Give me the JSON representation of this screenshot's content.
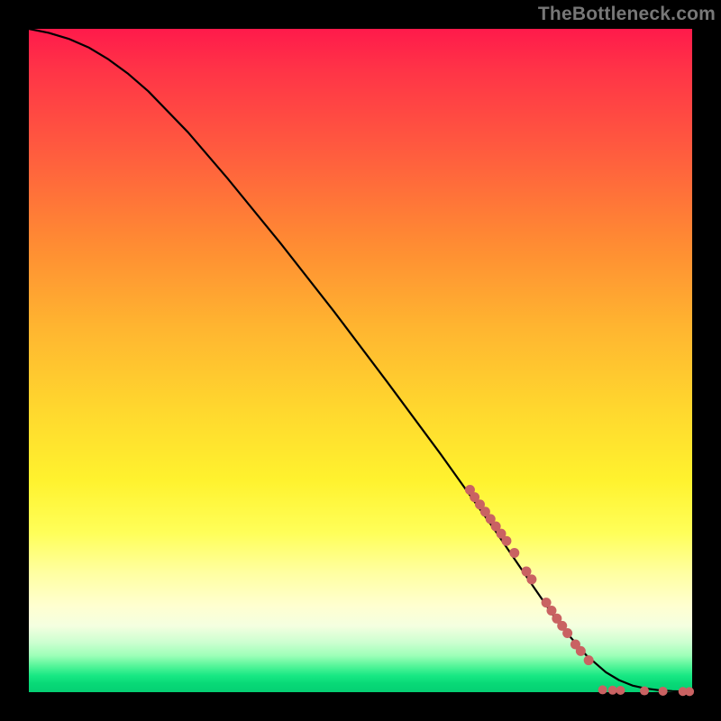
{
  "watermark": "TheBottleneck.com",
  "colors": {
    "dot": "#c96262",
    "curve": "#000000",
    "frame": "#000000"
  },
  "chart_data": {
    "type": "line",
    "title": "",
    "xlabel": "",
    "ylabel": "",
    "xlim": [
      0,
      100
    ],
    "ylim": [
      0,
      100
    ],
    "grid": false,
    "legend": null,
    "series": [
      {
        "name": "bottleneck-curve",
        "kind": "line",
        "x": [
          0,
          3,
          6,
          9,
          12,
          15,
          18,
          24,
          30,
          38,
          46,
          54,
          62,
          70,
          76,
          80,
          84,
          87,
          89,
          91,
          93,
          95,
          97,
          99,
          100
        ],
        "y": [
          100,
          99.4,
          98.5,
          97.2,
          95.4,
          93.2,
          90.6,
          84.4,
          77.4,
          67.6,
          57.4,
          46.8,
          36.0,
          24.8,
          16.0,
          10.2,
          5.6,
          3.0,
          1.8,
          1.0,
          0.55,
          0.3,
          0.16,
          0.08,
          0.06
        ]
      },
      {
        "name": "highlighted-points",
        "kind": "scatter",
        "points": [
          {
            "x": 66.5,
            "y": 30.5,
            "r": 5.5
          },
          {
            "x": 67.2,
            "y": 29.4,
            "r": 5.5
          },
          {
            "x": 68.0,
            "y": 28.3,
            "r": 5.5
          },
          {
            "x": 68.8,
            "y": 27.2,
            "r": 5.5
          },
          {
            "x": 69.6,
            "y": 26.1,
            "r": 5.5
          },
          {
            "x": 70.4,
            "y": 25.0,
            "r": 5.5
          },
          {
            "x": 71.2,
            "y": 23.9,
            "r": 5.5
          },
          {
            "x": 72.0,
            "y": 22.8,
            "r": 5.5
          },
          {
            "x": 73.2,
            "y": 21.0,
            "r": 5.5
          },
          {
            "x": 75.0,
            "y": 18.2,
            "r": 5.5
          },
          {
            "x": 75.8,
            "y": 17.0,
            "r": 5.5
          },
          {
            "x": 78.0,
            "y": 13.5,
            "r": 5.5
          },
          {
            "x": 78.8,
            "y": 12.3,
            "r": 5.5
          },
          {
            "x": 79.6,
            "y": 11.1,
            "r": 5.5
          },
          {
            "x": 80.4,
            "y": 10.0,
            "r": 5.5
          },
          {
            "x": 81.2,
            "y": 8.9,
            "r": 5.5
          },
          {
            "x": 82.4,
            "y": 7.2,
            "r": 5.5
          },
          {
            "x": 83.2,
            "y": 6.2,
            "r": 5.5
          },
          {
            "x": 84.4,
            "y": 4.8,
            "r": 5.5
          },
          {
            "x": 86.5,
            "y": 0.35,
            "r": 5.0
          },
          {
            "x": 88.0,
            "y": 0.3,
            "r": 5.0
          },
          {
            "x": 89.2,
            "y": 0.27,
            "r": 5.0
          },
          {
            "x": 92.8,
            "y": 0.2,
            "r": 5.0
          },
          {
            "x": 95.6,
            "y": 0.14,
            "r": 5.0
          },
          {
            "x": 98.6,
            "y": 0.1,
            "r": 5.0
          },
          {
            "x": 99.6,
            "y": 0.09,
            "r": 5.0
          }
        ]
      }
    ]
  }
}
